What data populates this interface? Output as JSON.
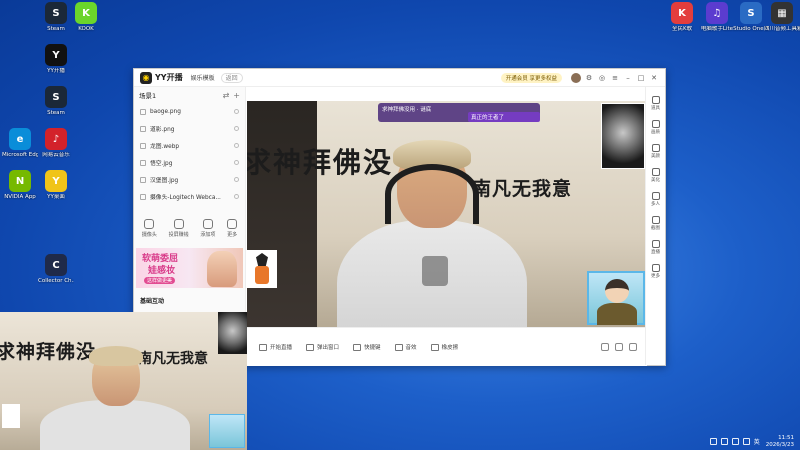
{
  "desktop": {
    "left_icons": [
      {
        "label": "Steam",
        "name": "steam-desktop-icon",
        "color": "#1b2838",
        "glyph": "S"
      },
      {
        "label": "KOOK",
        "name": "kook-desktop-icon",
        "color": "#6bd52b",
        "glyph": "K"
      },
      {
        "label": "YY开播",
        "name": "yy-live-desktop-icon",
        "color": "#111111",
        "glyph": "Y"
      },
      {
        "label": "Steam",
        "name": "steam2-desktop-icon",
        "color": "#1b2838",
        "glyph": "S"
      },
      {
        "label": "Microsoft Edge",
        "name": "edge-desktop-icon",
        "color": "#0a8dd9",
        "glyph": "e"
      },
      {
        "label": "网易云音乐",
        "name": "netease-music-desktop-icon",
        "color": "#d3222a",
        "glyph": "♪"
      },
      {
        "label": "NVIDIA App",
        "name": "nvidia-desktop-icon",
        "color": "#76b900",
        "glyph": "N"
      },
      {
        "label": "YY桌面",
        "name": "yy-desktop-icon",
        "color": "#f0c419",
        "glyph": "Y"
      },
      {
        "label": "Collector Ch...",
        "name": "collector-desktop-icon",
        "color": "#1f2a4a",
        "glyph": "C"
      }
    ],
    "right_icons": [
      {
        "label": "全民K歌",
        "name": "kge-desktop-icon",
        "color": "#e33d3d",
        "glyph": "K"
      },
      {
        "label": "电脑歌手Lite",
        "name": "singer-lite-desktop-icon",
        "color": "#5b3ccf",
        "glyph": "♫"
      },
      {
        "label": "Studio One 7",
        "name": "studio-one-desktop-icon",
        "color": "#2a6bc4",
        "glyph": "S"
      },
      {
        "label": "四川音频工具箱",
        "name": "audio-toolbox-desktop-icon",
        "color": "#333333",
        "glyph": "▦"
      }
    ]
  },
  "window": {
    "brand": "YY开播",
    "template_button": "娱乐模板",
    "back_button": "返回",
    "vip_text": "开通会员 享更多权益"
  },
  "scene": {
    "title": "场景1",
    "sources": [
      "baoge.png",
      "道影.png",
      "龙图.webp",
      "悟空.jpg",
      "汉堡图.jpg",
      "摄像头-Logitech Webca..."
    ]
  },
  "tools": [
    {
      "label": "摄像头",
      "name": "tool-camera"
    },
    {
      "label": "投屏赚钱",
      "name": "tool-screencast"
    },
    {
      "label": "添加项",
      "name": "tool-add-item"
    },
    {
      "label": "更多",
      "name": "tool-more"
    }
  ],
  "banner": {
    "line1": "软萌委屈",
    "line2": "娃感妆",
    "cta": "这样做更美"
  },
  "interact_title": "基础互动",
  "preview": {
    "callig_main": "求神拜佛没",
    "callig_right": "南凡无我意",
    "gift_text": "求神拜佛没用 · 谜底",
    "gift_line2": "真正的王者了"
  },
  "bottom_bar": [
    "开始直播",
    "弹出窗口",
    "快捷键",
    "音效",
    "橡皮擦"
  ],
  "right_bar": [
    "道具",
    "画质",
    "美颜",
    "美化",
    "多人",
    "截图",
    "直播",
    "更多"
  ],
  "secondary": {
    "callig_main": "求神拜佛没",
    "callig_right": "南凡无我意"
  },
  "tray": {
    "ime": "英",
    "time": "11:51",
    "date": "2026/3/23"
  },
  "accent": "#ffd200"
}
